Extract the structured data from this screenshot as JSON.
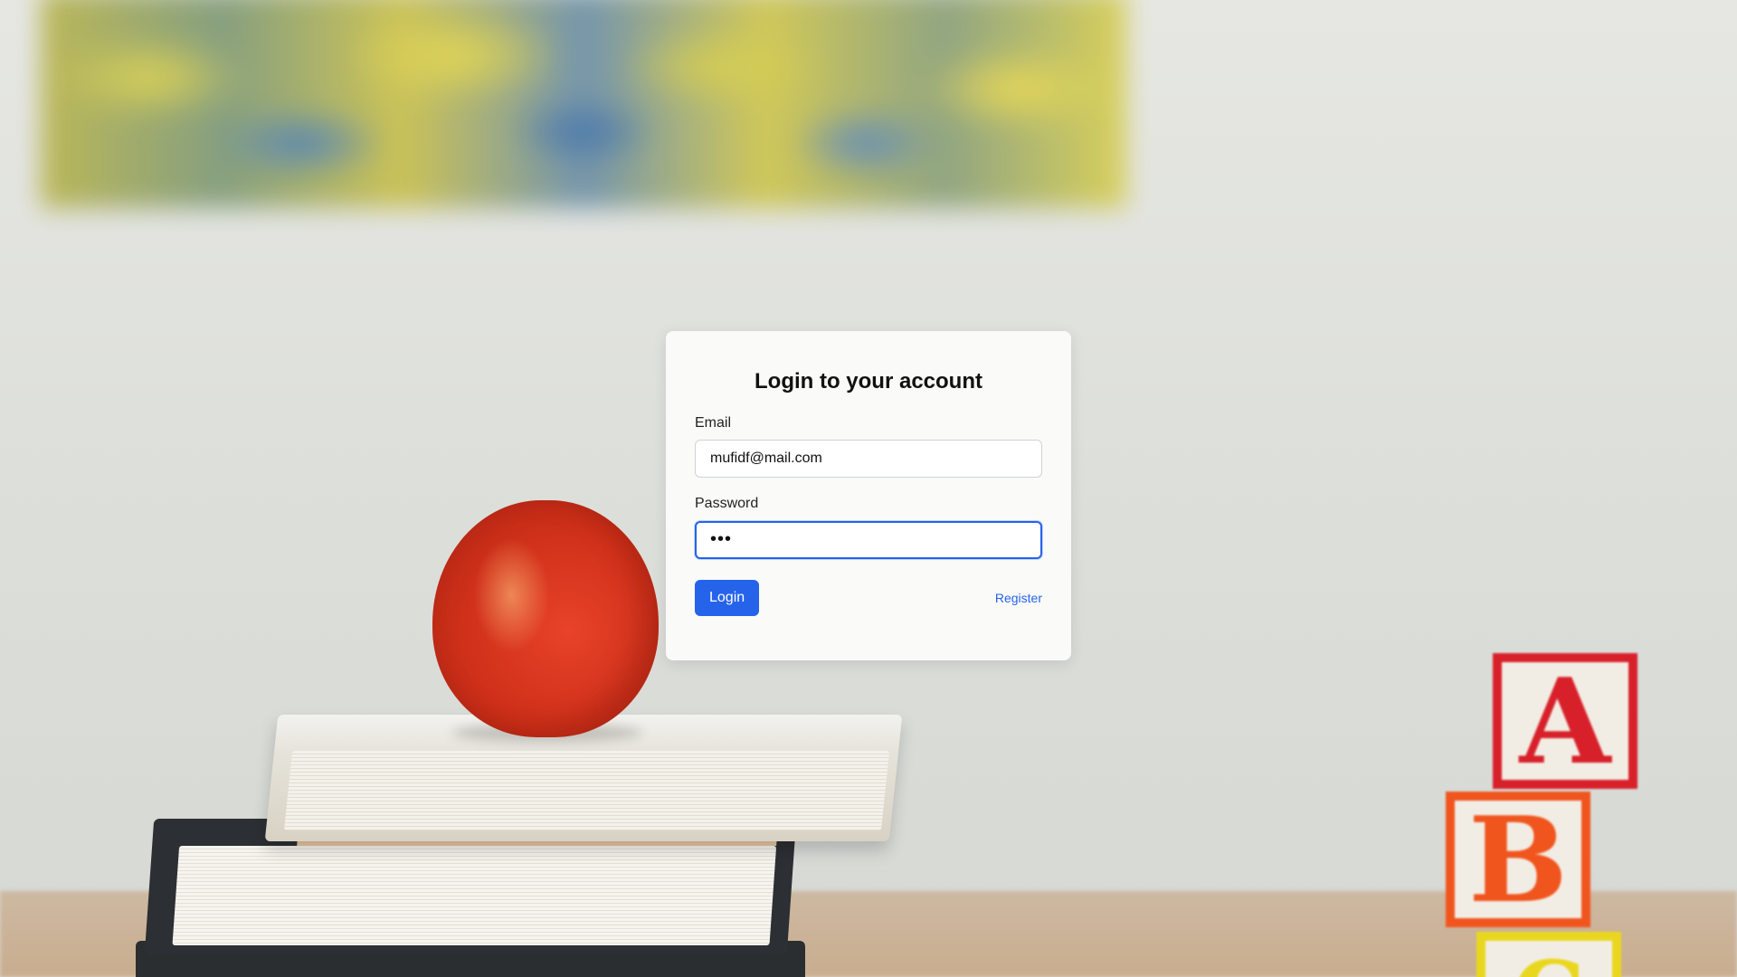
{
  "login": {
    "title": "Login to your account",
    "email_label": "Email",
    "email_value": "mufidf@mail.com",
    "password_label": "Password",
    "password_value": "abc",
    "login_button": "Login",
    "register_link": "Register"
  },
  "background": {
    "blocks": [
      "A",
      "B",
      "C"
    ]
  },
  "colors": {
    "accent": "#2563eb",
    "card_bg": "#fafaf9"
  }
}
